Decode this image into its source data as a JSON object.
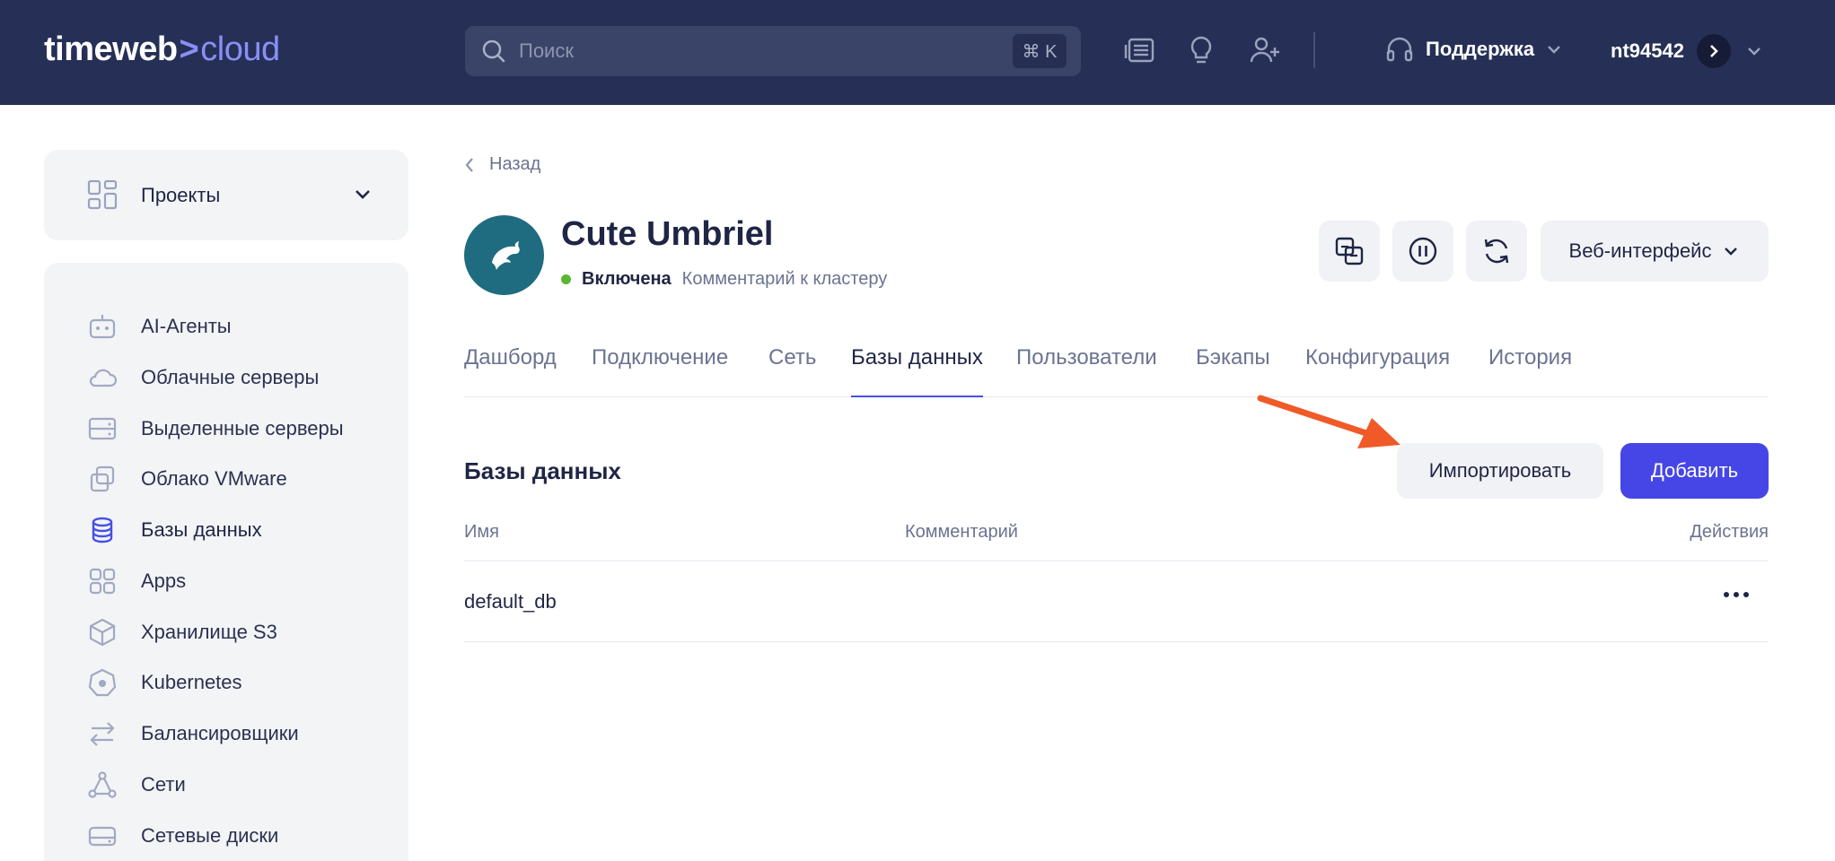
{
  "header": {
    "logo_left": "timeweb",
    "logo_sep": ">",
    "logo_right": "cloud",
    "search_placeholder": "Поиск",
    "search_shortcut": "⌘ K",
    "support_label": "Поддержка",
    "username": "nt94542"
  },
  "sidebar": {
    "projects_label": "Проекты",
    "items": [
      {
        "label": "AI-Агенты",
        "icon": "robot-icon"
      },
      {
        "label": "Облачные серверы",
        "icon": "cloud-icon"
      },
      {
        "label": "Выделенные серверы",
        "icon": "server-icon"
      },
      {
        "label": "Облако VMware",
        "icon": "vmware-icon"
      },
      {
        "label": "Базы данных",
        "icon": "database-icon",
        "active": true
      },
      {
        "label": "Apps",
        "icon": "apps-icon"
      },
      {
        "label": "Хранилище S3",
        "icon": "cube-icon"
      },
      {
        "label": "Kubernetes",
        "icon": "kubernetes-icon"
      },
      {
        "label": "Балансировщики",
        "icon": "balancer-icon"
      },
      {
        "label": "Сети",
        "icon": "network-icon"
      },
      {
        "label": "Сетевые диски",
        "icon": "disk-icon"
      }
    ]
  },
  "main": {
    "back_label": "Назад",
    "cluster_name": "Cute Umbriel",
    "status": "Включена",
    "comment_placeholder": "Комментарий к кластеру",
    "web_interface_label": "Веб-интерфейс",
    "tabs": [
      "Дашборд",
      "Подключение",
      "Сеть",
      "Базы данных",
      "Пользователи",
      "Бэкапы",
      "Конфигурация",
      "История"
    ],
    "active_tab": "Базы данных",
    "section_title": "Базы данных",
    "import_label": "Импортировать",
    "add_label": "Добавить",
    "table": {
      "columns": [
        "Имя",
        "Комментарий",
        "Действия"
      ],
      "rows": [
        {
          "name": "default_db",
          "comment": ""
        }
      ]
    }
  },
  "colors": {
    "header_bg": "#263056",
    "accent": "#4646e6",
    "status_on": "#57b82d",
    "arrow": "#f05a28"
  }
}
